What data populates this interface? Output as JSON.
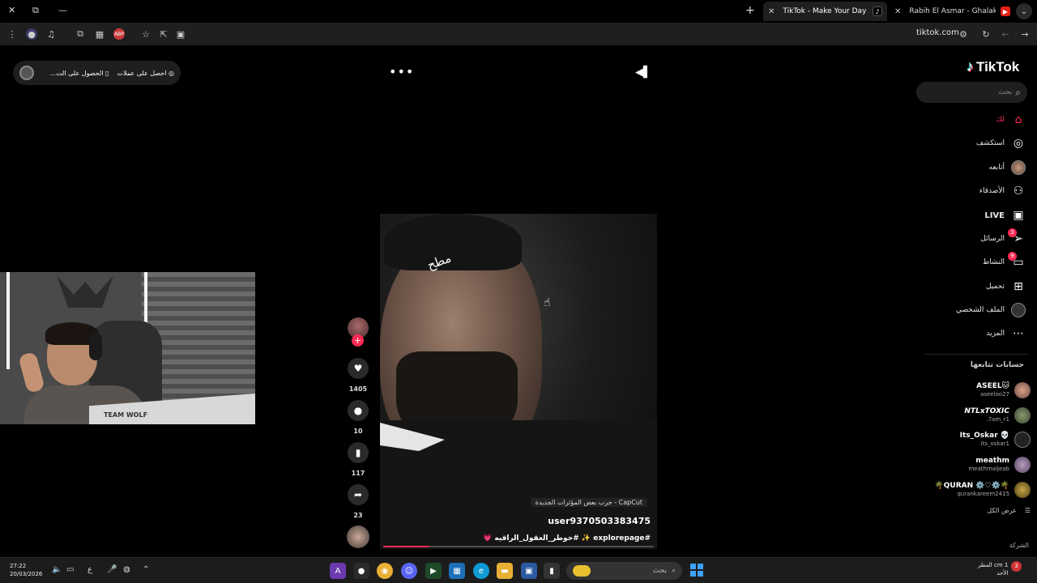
{
  "browser": {
    "tabs": [
      {
        "title": "TikTok - Make Your Day",
        "active": true
      },
      {
        "title": "Rabih El Asmar - Ghalak / غلاك",
        "active": false
      }
    ],
    "url": "tiktok.com",
    "extension_abp": "ABP"
  },
  "overlay": {
    "get_coins": "احصل على عملات",
    "get_app": "الحصول على الت..."
  },
  "video": {
    "tattoo_text": "مطح",
    "capcut_label": "CapCut - جرب بعض المؤثرات الجديدة",
    "username": "user9370503383475",
    "hashtags": "#explorepage ✨ #خوطر_العقول_الراقيه 💗",
    "progress_fraction": 0.17
  },
  "actions": {
    "likes": "1405",
    "comments": "10",
    "saves": "117",
    "shares": "23"
  },
  "webcam": {
    "banner_text": "TEAM WOLF"
  },
  "sidebar": {
    "logo": "TikTok",
    "search_placeholder": "بحث",
    "nav": [
      {
        "label": "لك",
        "icon": "home-icon"
      },
      {
        "label": "استكشف",
        "icon": "compass-icon"
      },
      {
        "label": "أتابعه",
        "icon": "avatar"
      },
      {
        "label": "الأصدقاء",
        "icon": "friends-icon"
      },
      {
        "label": "LIVE",
        "icon": "live-icon"
      },
      {
        "label": "الرسائل",
        "icon": "messages-icon",
        "badge": "3"
      },
      {
        "label": "النشاط",
        "icon": "activity-icon",
        "badge": "9"
      },
      {
        "label": "تحميل",
        "icon": "upload-icon"
      },
      {
        "label": "الملف الشخصي",
        "icon": "profile-avatar"
      },
      {
        "label": "المزيد",
        "icon": "more-icon"
      }
    ],
    "following_title": "حسابات تتابعها",
    "accounts": [
      {
        "name": "ASEEL🐱",
        "handle": "aseeloo27"
      },
      {
        "name": "NTLxTOXIC",
        "handle": "7am_r1."
      },
      {
        "name": "Its_Oskar 💀",
        "handle": "its_oskar1"
      },
      {
        "name": "meathm",
        "handle": "meathmaljeab"
      },
      {
        "name": "🌴QURAN ⚙️♡⚙️🌴",
        "handle": "qurankareem2415"
      }
    ],
    "see_all": "عرض الكل",
    "company": "الشركة"
  },
  "taskbar": {
    "time": "27:22",
    "date": "20/03/2026",
    "lang": "ع",
    "search_placeholder": "بحث",
    "weather_temp": "1 cm المطر",
    "weather_day": "الأحد",
    "notif_count": "3"
  },
  "colors": {
    "accent": "#fe2c55",
    "tiktok_cyan": "#25f4ee",
    "background": "#000000"
  }
}
